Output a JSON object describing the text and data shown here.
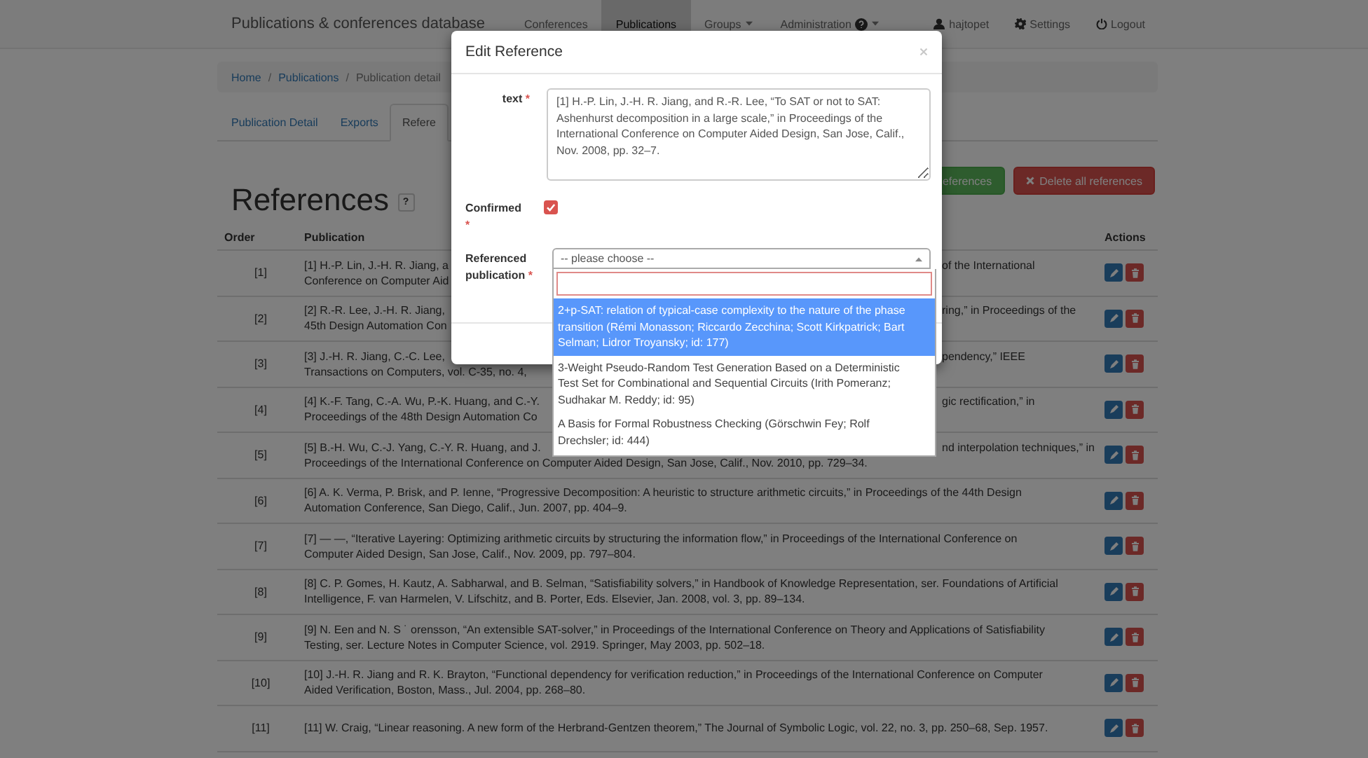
{
  "navbar": {
    "brand": "Publications & conferences database",
    "items": [
      {
        "label": "Conferences",
        "selected": false,
        "kind": "link"
      },
      {
        "label": "Publications",
        "selected": true,
        "kind": "link"
      },
      {
        "label": "Groups",
        "selected": false,
        "kind": "dropdown"
      },
      {
        "label": "Administration",
        "selected": false,
        "kind": "help-dropdown"
      }
    ],
    "right_items": [
      {
        "label": "hajtopet",
        "kind": "user"
      },
      {
        "label": "Settings",
        "kind": "settings"
      },
      {
        "label": "Logout",
        "kind": "logout"
      }
    ]
  },
  "breadcrumb": [
    {
      "label": "Home"
    },
    {
      "separator": "/",
      "label": "Publications"
    },
    {
      "separator": "/",
      "label": "Publication detail"
    }
  ],
  "tabs": [
    {
      "label": "Publication Detail",
      "selected": false
    },
    {
      "label": "Exports",
      "selected": false
    },
    {
      "label": "Refere",
      "selected": true
    }
  ],
  "heading": "References",
  "help_button": "?",
  "actions": [
    {
      "label": "eferences",
      "kind": "success"
    },
    {
      "label": "Delete all references",
      "kind": "danger"
    }
  ],
  "table": {
    "columns": [
      "Order",
      "Publication",
      "Actions"
    ],
    "rows": [
      {
        "order": "[1]",
        "lines": [
          {
            "left": "[1] H.-P. Lin, J.-H. R. Jiang, a",
            "right": "of the International"
          },
          {
            "left": "Conference on Computer Aid"
          }
        ]
      },
      {
        "order": "[2]",
        "lines": [
          {
            "left": "[2] R.-R. Lee, J.-H. R. Jiang,",
            "right": "ring,” in Proceedings of the"
          },
          {
            "left": "45th Design Automation Con"
          }
        ]
      },
      {
        "order": "[3]",
        "lines": [
          {
            "left": "[3] J.-H. R. Jiang, C.-C. Lee,",
            "right": "pendency,” IEEE"
          },
          {
            "left": "Transactions on Computers, vol. C-35, no. 4,"
          }
        ]
      },
      {
        "order": "[4]",
        "lines": [
          {
            "left": "[4] K.-F. Tang, C.-A. Wu, P.-K. Huang, and C.-Y.",
            "right": "gic rectification,” in"
          },
          {
            "left": "Proceedings of the 48th Design Automation Co"
          }
        ]
      },
      {
        "order": "[5]",
        "lines": [
          {
            "left": "[5] B.-H. Wu, C.-J. Yang, C.-Y. R. Huang, and J.",
            "right": "nd interpolation techniques,” in"
          },
          {
            "left": "Proceedings of the International Conference on Computer Aided Design, San Jose, Calif., Nov. 2010, pp. 729–34."
          }
        ]
      },
      {
        "order": "[6]",
        "lines": [
          {
            "left": "[6] A. K. Verma, P. Brisk, and P. Ienne, “Progressive Decomposition: A heuristic to structure arithmetic circuits,” in Proceedings of the 44th Design"
          },
          {
            "left": "Automation Conference, San Diego, Calif., Jun. 2007, pp. 404–9."
          }
        ]
      },
      {
        "order": "[7]",
        "lines": [
          {
            "left": "[7] — —, “Iterative Layering: Optimizing arithmetic circuits by structuring the information flow,” in Proceedings of the International Conference on"
          },
          {
            "left": "Computer Aided Design, San Jose, Calif., Nov. 2009, pp. 797–804."
          }
        ]
      },
      {
        "order": "[8]",
        "lines": [
          {
            "left": "[8] C. P. Gomes, H. Kautz, A. Sabharwal, and B. Selman, “Satisfiability solvers,” in Handbook of Knowledge Representation, ser. Foundations of Artificial"
          },
          {
            "left": "Intelligence, F. van Harmelen, V. Lifschitz, and B. Porter, Eds. Elsevier, Jan. 2008, vol. 3, pp. 89–134."
          }
        ]
      },
      {
        "order": "[9]",
        "lines": [
          {
            "left": "[9] N. Een and N. S ˙ orensson, “An extensible SAT-solver,” in Proceedings of the International Conference on Theory and Applications of Satisfiability"
          },
          {
            "left": "Testing, ser. Lecture Notes in Computer Science, vol. 2919. Springer, May 2003, pp. 502–18."
          }
        ]
      },
      {
        "order": "[10]",
        "lines": [
          {
            "left": "[10] J.-H. R. Jiang and R. K. Brayton, “Functional dependency for verification reduction,” in Proceedings of the International Conference on Computer"
          },
          {
            "left": "Aided Verification, Boston, Mass., Jul. 2004, pp. 268–80."
          }
        ]
      },
      {
        "order": "[11]",
        "lines": [
          {
            "left": "[11] W. Craig, “Linear reasoning. A new form of the Herbrand-Gentzen theorem,” The Journal of Symbolic Logic, vol. 22, no. 3, pp. 250–68, Sep. 1957."
          }
        ]
      }
    ]
  },
  "modal": {
    "title": "Edit Reference",
    "text_field": {
      "label": "text",
      "required": "*",
      "value": "[1] H.-P. Lin, J.-H. R. Jiang, and R.-R. Lee, “To SAT or not to SAT: Ashenhurst decomposition in a large scale,” in Proceedings of the International Conference on Computer Aided Design, San Jose, Calif., Nov. 2008, pp. 32–7."
    },
    "confirmed": {
      "label": "Confirmed",
      "required": "*",
      "checked": true
    },
    "referenced": {
      "label": "Referenced publication",
      "required": "*",
      "placeholder": "-- please choose --",
      "options": [
        {
          "label": "2+p-SAT: relation of typical-case complexity to the nature of the phase transition (Rémi Monasson; Riccardo Zecchina; Scott Kirkpatrick; Bart Selman; Lidror Troyansky; id: 177)",
          "selected": true
        },
        {
          "label": "3-Weight Pseudo-Random Test Generation Based on a Deterministic Test Set for Combinational and Sequential Circuits (Irith Pomeranz; Sudhakar M. Reddy; id: 95)",
          "selected": false
        },
        {
          "label": "A Basis for Formal Robustness Checking (Görschwin Fey; Rolf Drechsler; id: 444)",
          "selected": false
        }
      ]
    }
  }
}
